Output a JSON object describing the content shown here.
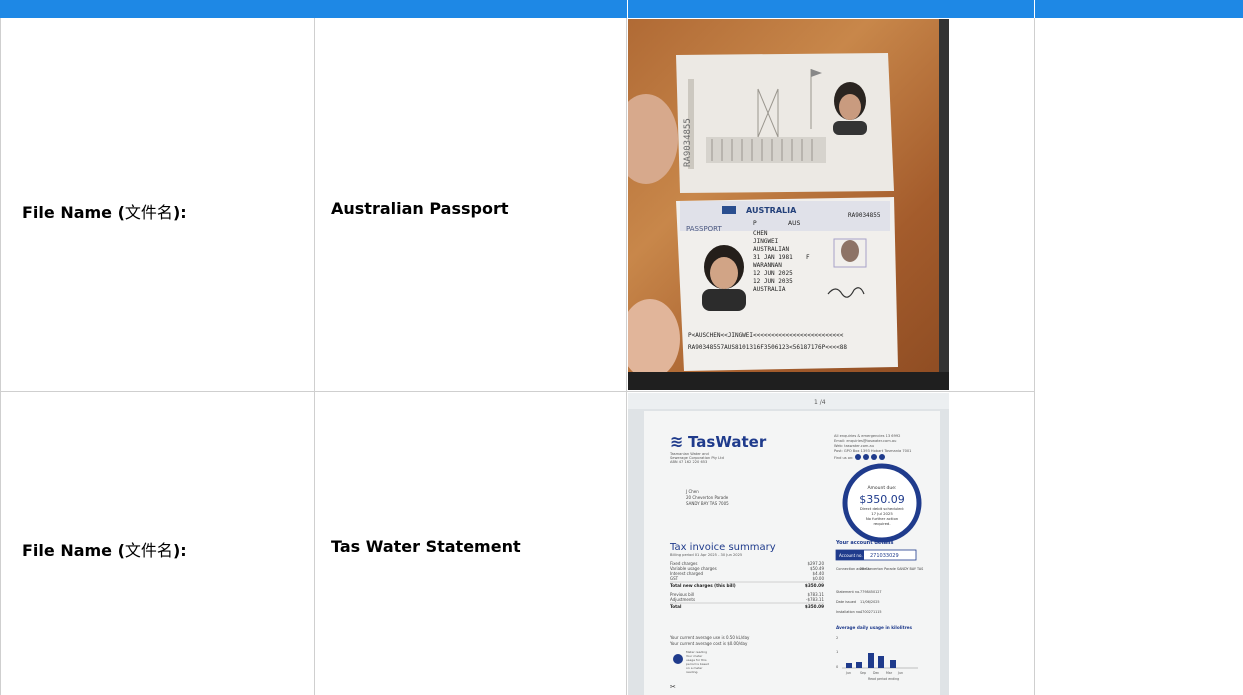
{
  "rows": [
    {
      "label_prefix": "File Name (",
      "label_cjk": "文件名",
      "label_suffix": "):",
      "file_name": "Australian Passport",
      "photo": {
        "page_top_text": "RA9034855",
        "country": "AUSTRALIA",
        "doc_type": "PASSPORT",
        "type_code": "P",
        "country_code": "AUS",
        "passport_no": "RA9034855",
        "surname": "CHEN",
        "given_names": "JINGWEI",
        "nationality": "AUSTRALIAN",
        "dob": "31 JAN 1981",
        "sex": "F",
        "place_of_birth": "WARANNAN",
        "issue_date": "12 JUN 2025",
        "expiry_date": "12 JUN 2035",
        "authority": "AUSTRALIA",
        "mrz1": "P<AUSCHEN<<JINGWEI<<<<<<<<<<<<<<<<<<<<<<<<<",
        "mrz2": "RA90348557AUS8101316F3506123<56187176P<<<<88"
      }
    },
    {
      "label_prefix": "File Name (",
      "label_cjk": "文件名",
      "label_suffix": "):",
      "file_name": "Tas Water Statement",
      "photo": {
        "brand": "TasWater",
        "company_lines": [
          "Tasmanian Water and",
          "Sewerage Corporation Pty Ltd",
          "ABN 47 162 220 653"
        ],
        "contact": [
          "All enquiries & emergencies 13 6992",
          "Email: enquiries@taswater.com.au",
          "Web: taswater.com.au",
          "Post: GPO Box 1393 Hobart Tasmania 7001",
          "Find us on:"
        ],
        "address": [
          "J Chen",
          "20 Cheverton Parade",
          "SANDY BAY TAS 7005"
        ],
        "amount_due_label": "Amount due:",
        "amount_due": "$350.09",
        "direct_debit": [
          "Direct debit scheduled:",
          "17 Jul 2025",
          "No further action",
          "required."
        ],
        "summary_title": "Tax invoice summary",
        "billing_period": "Billing period 01 Apr 2025 - 30 Jun 2025",
        "charges": [
          {
            "label": "Fixed charges",
            "value": "$297.20"
          },
          {
            "label": "Variable usage charges",
            "value": "$50.49"
          },
          {
            "label": "Interest charged",
            "value": "$4.40"
          },
          {
            "label": "GST",
            "value": "$0.00"
          }
        ],
        "total_new_label": "Total new charges (this bill)",
        "total_new": "$350.09",
        "previous_bill_label": "Previous bill",
        "previous_bill": "$783.11",
        "adjustments_label": "Adjustments",
        "adjustments": "-$783.11",
        "total_label": "Total",
        "total": "$350.09",
        "avg_use": "Your current average use is 0.50 kL/day",
        "avg_cost": "Your current average cost is $0.00/day",
        "meter_note": [
          "Meter reading",
          "Your meter",
          "usage for this",
          "period is based",
          "on a meter",
          "reading."
        ],
        "account_title": "Your account details",
        "account_no_label": "Account no.",
        "account_no": "271033029",
        "connection_label": "Connection address",
        "connection_value": "20 Cheverton Parade SANDY BAY TAS",
        "statement_no_label": "Statement no.",
        "statement_no": "7798450127",
        "date_issued_label": "Date issued",
        "date_issued": "11/06/2025",
        "installation_label": "Installation no.",
        "installation_no": "4700271115",
        "chart_title": "Average daily usage in kilolitres",
        "chart_y": [
          "2",
          "1",
          "0"
        ],
        "chart_x": [
          "Jun",
          "Sep",
          "Dec",
          "Mar",
          "Jun"
        ],
        "chart_caption": "Read period ending",
        "viewer_toolbar": "1 /4"
      }
    }
  ]
}
